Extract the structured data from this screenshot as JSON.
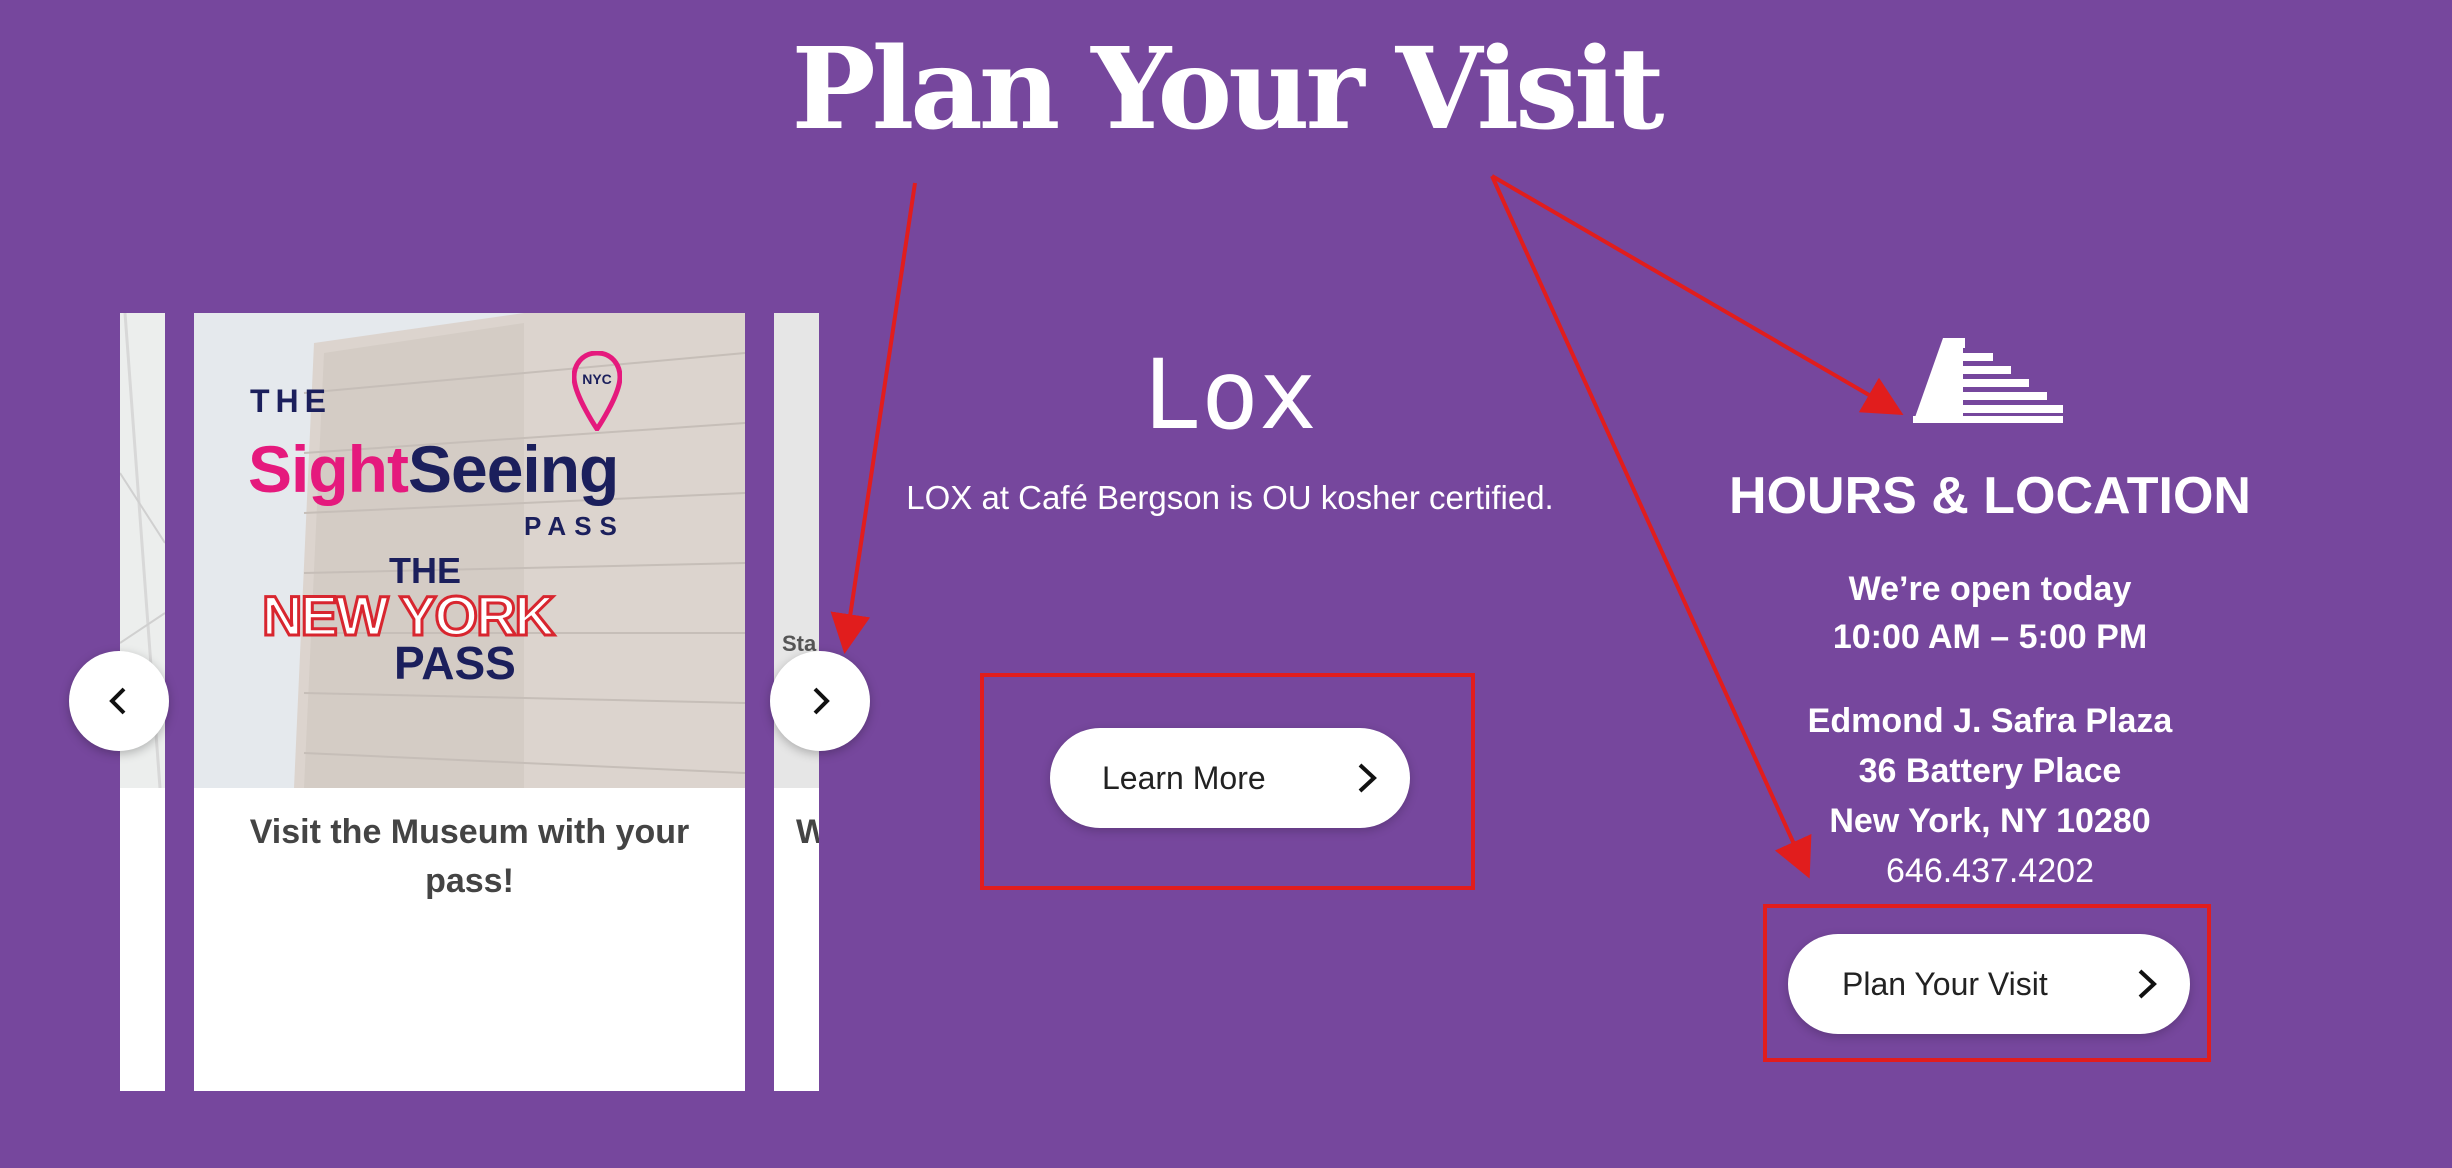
{
  "header": {
    "title": "Plan Your Visit"
  },
  "carousel": {
    "prev_label": "Previous",
    "next_label": "Next",
    "main_card": {
      "logo_the": "THE",
      "logo_sightseeing_a": "Sight",
      "logo_sightseeing_b": "Seeing",
      "logo_pass": "PASS",
      "logo_pin": "NYC",
      "logo_the2": "THE",
      "logo_newyork": "NEW YORK",
      "logo_pass2": "PASS",
      "text": "Visit the Museum with your pass!"
    },
    "right_card": {
      "img_text": "Sta",
      "text": "W"
    }
  },
  "dining": {
    "logo": "Lox",
    "description": "LOX at Café Bergson is OU kosher certified.",
    "button_label": "Learn More"
  },
  "hours": {
    "heading": "HOURS & LOCATION",
    "open_line": "We’re open today",
    "time": "10:00 AM – 5:00 PM",
    "address1": "Edmond J. Safra Plaza",
    "address2": "36 Battery Place",
    "address3": "New York, NY 10280",
    "phone": "646.437.4202",
    "button_label": "Plan Your Visit"
  },
  "colors": {
    "background": "#76479d",
    "annotation": "#e11d1d",
    "brand_pink": "#e5197d",
    "brand_navy": "#1b1f5c"
  }
}
